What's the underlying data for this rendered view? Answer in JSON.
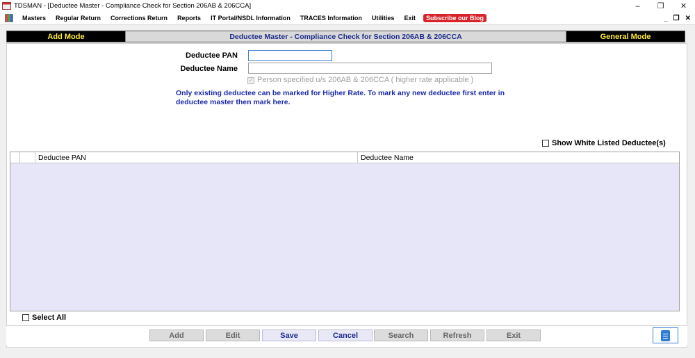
{
  "window": {
    "title": "TDSMAN - [Deductee Master - Compliance Check for Section 206AB & 206CCA]",
    "minimize": "–",
    "restore": "❐",
    "close": "✕"
  },
  "menu": {
    "items": [
      "Masters",
      "Regular Return",
      "Corrections Return",
      "Reports",
      "IT Portal/NSDL Information",
      "TRACES Information",
      "Utilities",
      "Exit"
    ],
    "blog": "Subscribe our Blog",
    "mdi_minimize": "_",
    "mdi_restore": "❐",
    "mdi_close": "✕"
  },
  "modebar": {
    "left": "Add Mode",
    "center": "Deductee Master - Compliance Check for Section 206AB & 206CCA",
    "right": "General Mode"
  },
  "form": {
    "pan_label": "Deductee PAN",
    "pan_value": "",
    "name_label": "Deductee Name",
    "name_value": "",
    "higher_rate_label": "Person specified u/s 206AB & 206CCA ( higher rate applicable )",
    "note": "Only existing deductee can be marked for Higher Rate. To mark any new deductee first enter in deductee master then mark here."
  },
  "whitelist_label": "Show White Listed Deductee(s)",
  "grid": {
    "columns": [
      "Deductee PAN",
      "Deductee Name"
    ]
  },
  "select_all_label": "Select All",
  "buttons": {
    "add": "Add",
    "edit": "Edit",
    "save": "Save",
    "cancel": "Cancel",
    "search": "Search",
    "refresh": "Refresh",
    "exit": "Exit"
  },
  "colors": {
    "mode_text": "#ffeb3b",
    "title_blue": "#1c2a8c",
    "note_blue": "#1c2aa8",
    "grid_bg": "#e6e6f8",
    "blog_red": "#d8232a"
  }
}
